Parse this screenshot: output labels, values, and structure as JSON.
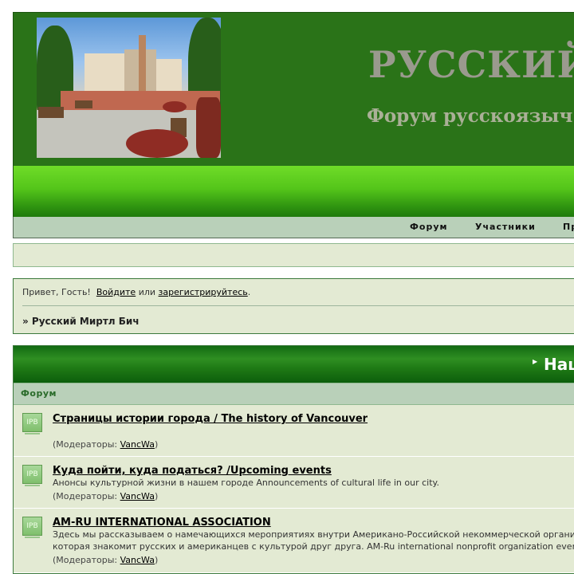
{
  "header": {
    "title": "РУССКИЙ",
    "subtitle": "Форум русскоязыч"
  },
  "nav": {
    "items": [
      {
        "label": "Форум"
      },
      {
        "label": "Участники"
      },
      {
        "label": "Пр"
      }
    ]
  },
  "welcome": {
    "greeting": "Привет, Гость!",
    "login_link": "Войдите",
    "or_text": "или",
    "register_link": "зарегистрируйтесь",
    "period": ".",
    "breadcrumb": "» Русский Миртл Бич"
  },
  "category": {
    "title": "Нац",
    "column_forum": "Форум"
  },
  "forums": [
    {
      "icon": "IPB",
      "name": "Страницы истории города / The history of Vancouver",
      "description_lines": [],
      "moderators_label": "(Модераторы:",
      "moderator": "VancWa",
      "moderators_close": ")"
    },
    {
      "icon": "IPB",
      "name": "Куда пойти, куда податься? /Upcoming events",
      "description_lines": [
        "Анонсы культурной жизни в нашем городе Announcements of cultural life in our city."
      ],
      "moderators_label": "(Модераторы:",
      "moderator": "VancWa",
      "moderators_close": ")"
    },
    {
      "icon": "IPB",
      "name": "AM-RU INTERNATIONAL ASSOCIATION",
      "description_lines": [
        "Здесь мы рассказываем о намечающихся мероприятиях внутри Американо-Российской некоммерческой органи",
        "которая знакомит русских и американцев с культурой друг друга. AM-Ru international nonprofit organization ever"
      ],
      "moderators_label": "(Модераторы:",
      "moderator": "VancWa",
      "moderators_close": ")"
    }
  ],
  "colors": {
    "header_green": "#2a7318",
    "band_green": "#54c51a",
    "nav_bg": "#b9d0b9",
    "panel_bg": "#e3ead3"
  }
}
